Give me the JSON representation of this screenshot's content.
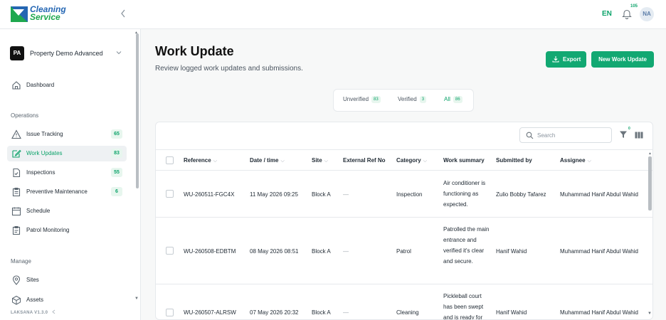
{
  "brand": {
    "line1": "Cleaning",
    "line2": "Service"
  },
  "topbar": {
    "language": "EN",
    "notification_count": "105",
    "user_initials": "NA"
  },
  "org": {
    "badge": "PA",
    "name": "Property Demo Advanced"
  },
  "sidebar": {
    "dashboard": "Dashboard",
    "operations_label": "Operations",
    "items": [
      {
        "label": "Issue Tracking",
        "count": "65"
      },
      {
        "label": "Work Updates",
        "count": "83"
      },
      {
        "label": "Inspections",
        "count": "55"
      },
      {
        "label": "Preventive Maintenance",
        "count": "6"
      },
      {
        "label": "Schedule",
        "count": ""
      },
      {
        "label": "Patrol Monitoring",
        "count": ""
      }
    ],
    "manage_label": "Manage",
    "manage_items": [
      {
        "label": "Sites"
      },
      {
        "label": "Assets"
      }
    ],
    "version": "LAKSANA V1.3.0"
  },
  "page": {
    "title": "Work Update",
    "subtitle": "Review logged work updates and submissions.",
    "export_label": "Export",
    "new_label": "New Work Update"
  },
  "tabs": [
    {
      "label": "Unverified",
      "count": "83"
    },
    {
      "label": "Verified",
      "count": "3"
    },
    {
      "label": "All",
      "count": "86"
    }
  ],
  "toolbar": {
    "search_placeholder": "Search",
    "filter_count": "0"
  },
  "table": {
    "headers": [
      "Reference",
      "Date / time",
      "Site",
      "External Ref No",
      "Category",
      "Work summary",
      "Submitted by",
      "Assignee"
    ],
    "rows": [
      {
        "reference": "WU-260511-FGC4X",
        "datetime": "11 May 2026 09:25",
        "site": "Block A",
        "external_ref": "—",
        "category": "Inspection",
        "summary": "Air conditioner is functioning as expected.",
        "submitted_by": "Zulio Bobby Tafarez",
        "assignee": "Muhammad Hanif Abdul Wahid"
      },
      {
        "reference": "WU-260508-EDBTM",
        "datetime": "08 May 2026 08:51",
        "site": "Block A",
        "external_ref": "—",
        "category": "Patrol",
        "summary": "Patrolled the main entrance and verified it's clear and secure.",
        "submitted_by": "Hanif Wahid",
        "assignee": "Muhammad Hanif Abdul Wahid"
      },
      {
        "reference": "WU-260507-ALRSW",
        "datetime": "07 May 2026 20:32",
        "site": "Block A",
        "external_ref": "—",
        "category": "Cleaning",
        "summary": "Pickleball court has been swept and is ready for",
        "submitted_by": "Hanif Wahid",
        "assignee": "Muhammad Hanif Abdul Wahid"
      }
    ]
  },
  "colors": {
    "accent": "#12a872",
    "brand_blue": "#2466b3",
    "brand_green": "#1fa84f"
  }
}
